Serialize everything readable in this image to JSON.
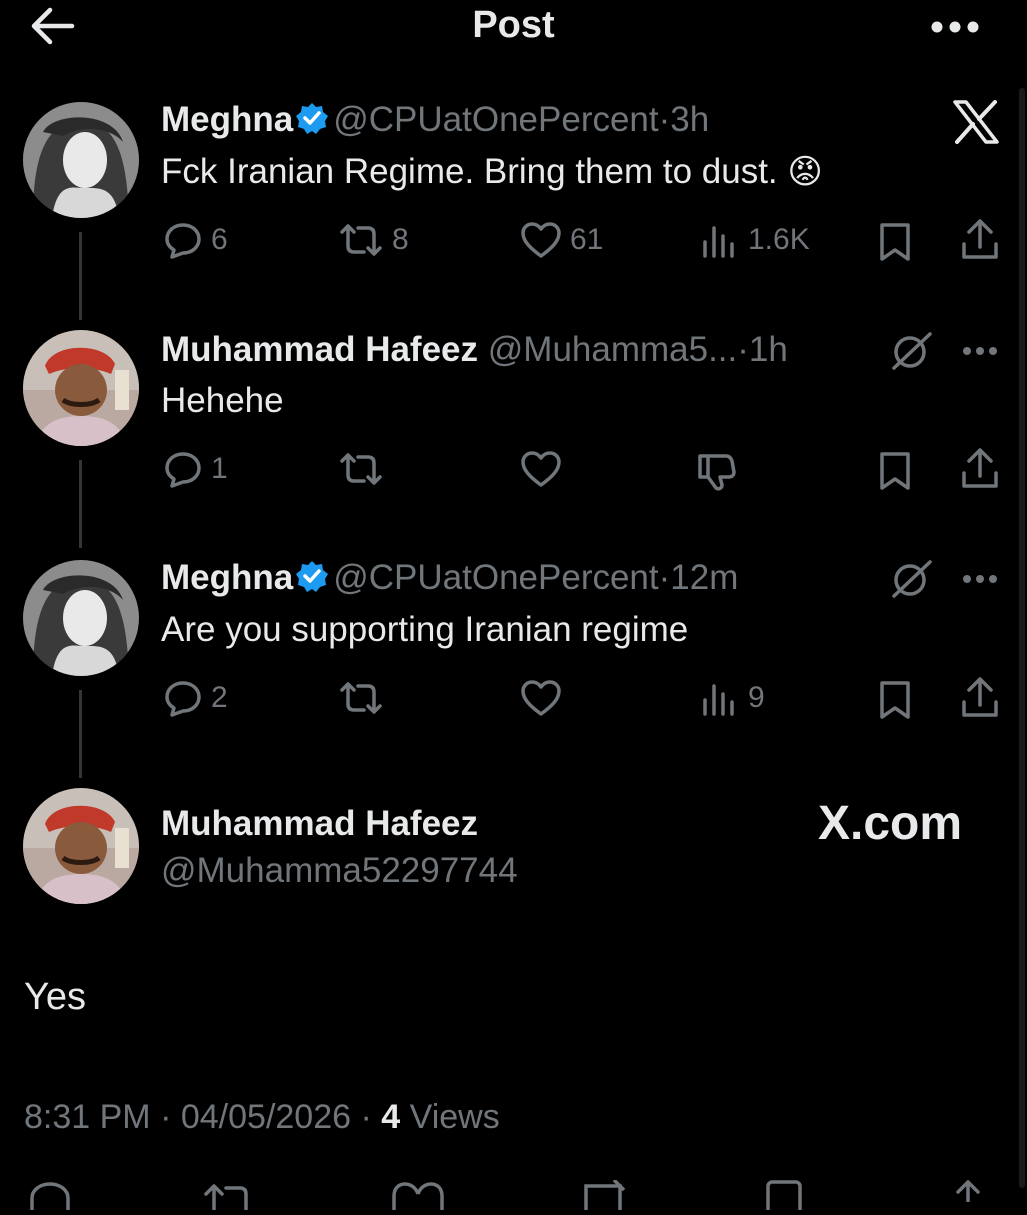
{
  "header": {
    "title": "Post"
  },
  "tweets": [
    {
      "name": "Meghna",
      "handle": "@CPUatOnePercent",
      "sep": "·",
      "time": "3h",
      "text": "Fck Iranian Regime. Bring them to dust.",
      "emoji": "😡",
      "actions": {
        "replies": "6",
        "reposts": "8",
        "likes": "61",
        "views": "1.6K"
      }
    },
    {
      "name": "Muhammad Hafeez",
      "handle": "@Muhamma5...",
      "sep": "·",
      "time": "1h",
      "text": "Hehehe",
      "actions": {
        "replies": "1"
      }
    },
    {
      "name": "Meghna",
      "handle": "@CPUatOnePercent",
      "sep": "·",
      "time": "12m",
      "text": "Are you supporting Iranian regime",
      "actions": {
        "replies": "2",
        "views": "9"
      }
    }
  ],
  "focused": {
    "name": "Muhammad Hafeez",
    "handle": "@Muhamma52297744",
    "watermark": "X.com",
    "text": "Yes",
    "time": "8:31 PM",
    "date": "04/05/2026",
    "views_count": "4",
    "views_label": "Views",
    "sep": "·"
  },
  "colors": {
    "background": "#000000",
    "text": "#e7e9ea",
    "muted": "#71767b",
    "verified": "#1d9bf0"
  }
}
